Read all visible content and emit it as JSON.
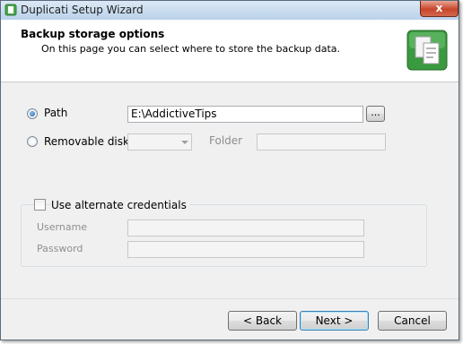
{
  "window": {
    "title": "Duplicati Setup Wizard",
    "close_glyph": "x"
  },
  "header": {
    "title": "Backup storage options",
    "subtitle": "On this page you can select where to store the backup data.",
    "icon": "documents-icon"
  },
  "storage": {
    "path_label": "Path",
    "path_value": "E:\\AddictiveTips",
    "path_selected": true,
    "browse_label": "...",
    "removable_label": "Removable disk",
    "removable_selected": false,
    "removable_value": "",
    "folder_label": "Folder",
    "folder_value": ""
  },
  "credentials": {
    "checkbox_label": "Use alternate credentials",
    "checked": false,
    "username_label": "Username",
    "username_value": "",
    "password_label": "Password",
    "password_value": ""
  },
  "buttons": {
    "back": "< Back",
    "next": "Next >",
    "cancel": "Cancel"
  },
  "colors": {
    "accent": "#3c7fb1",
    "disabled_text": "#8e8e8e",
    "header_icon": "#3a9a3f"
  }
}
